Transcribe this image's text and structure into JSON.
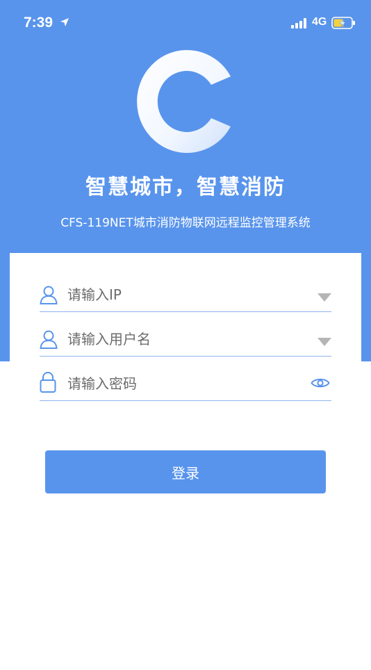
{
  "status_bar": {
    "time": "7:39",
    "network": "4G",
    "icons": [
      "location-arrow-icon",
      "signal-bars-icon",
      "battery-charging-icon"
    ]
  },
  "brand": {
    "logo_icon": "c-logo-icon",
    "slogan": "智慧城市，智慧消防",
    "subtitle": "CFS-119NET城市消防物联网远程监控管理系统"
  },
  "form": {
    "ip": {
      "placeholder": "请输入IP",
      "icon": "user-icon",
      "trailing_icon": "dropdown-triangle-icon"
    },
    "username": {
      "placeholder": "请输入用户名",
      "icon": "user-icon",
      "trailing_icon": "dropdown-triangle-icon"
    },
    "password": {
      "placeholder": "请输入密码",
      "icon": "lock-icon",
      "trailing_icon": "eye-icon"
    },
    "login_label": "登录"
  },
  "colors": {
    "primary": "#5894ec",
    "underline": "#8fb3ee",
    "background": "#ffffff"
  }
}
